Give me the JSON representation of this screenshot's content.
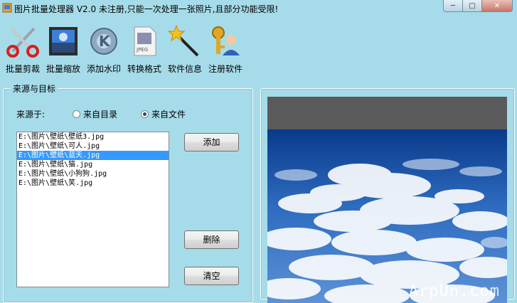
{
  "window": {
    "title": "图片批量处理器 V2.0  未注册,只能一次处理一张照片,且部分功能受限!",
    "minimize_symbol": "─",
    "maximize_symbol": "□",
    "close_symbol": "✕"
  },
  "toolbar": {
    "items": [
      {
        "label": "批量剪裁",
        "icon": "scissors-icon"
      },
      {
        "label": "批量缩放",
        "icon": "photo-frame-icon"
      },
      {
        "label": "添加水印",
        "icon": "gear-k-icon"
      },
      {
        "label": "转换格式",
        "icon": "jpeg-file-icon"
      },
      {
        "label": "软件信息",
        "icon": "magic-wand-icon"
      },
      {
        "label": "注册软件",
        "icon": "keys-user-icon"
      }
    ]
  },
  "source_group": {
    "title": "来源与目标",
    "source_label": "来源于:",
    "options": [
      {
        "label": "来自目录",
        "selected": false
      },
      {
        "label": "来自文件",
        "selected": true
      }
    ],
    "files": [
      "E:\\图片\\壁纸\\壁纸3.jpg",
      "E:\\图片\\壁纸\\可人.jpg",
      "E:\\图片\\壁纸\\蓝天.jpg",
      "E:\\图片\\壁纸\\猫.jpg",
      "E:\\图片\\壁纸\\小狗狗.jpg",
      "E:\\图片\\壁纸\\笑.jpg"
    ],
    "selected_index": 2,
    "add_label": "添加",
    "delete_label": "删除",
    "clear_label": "清空"
  },
  "preview": {
    "watermark": "ArpUn.com",
    "colors": {
      "sky_top": "#0b3d8c",
      "sky_mid": "#3a78c4",
      "cloud": "#ffffff",
      "bar": "#5a5a5a"
    }
  },
  "colors": {
    "window_bg": "#a6dce9",
    "selection": "#3399ff"
  }
}
